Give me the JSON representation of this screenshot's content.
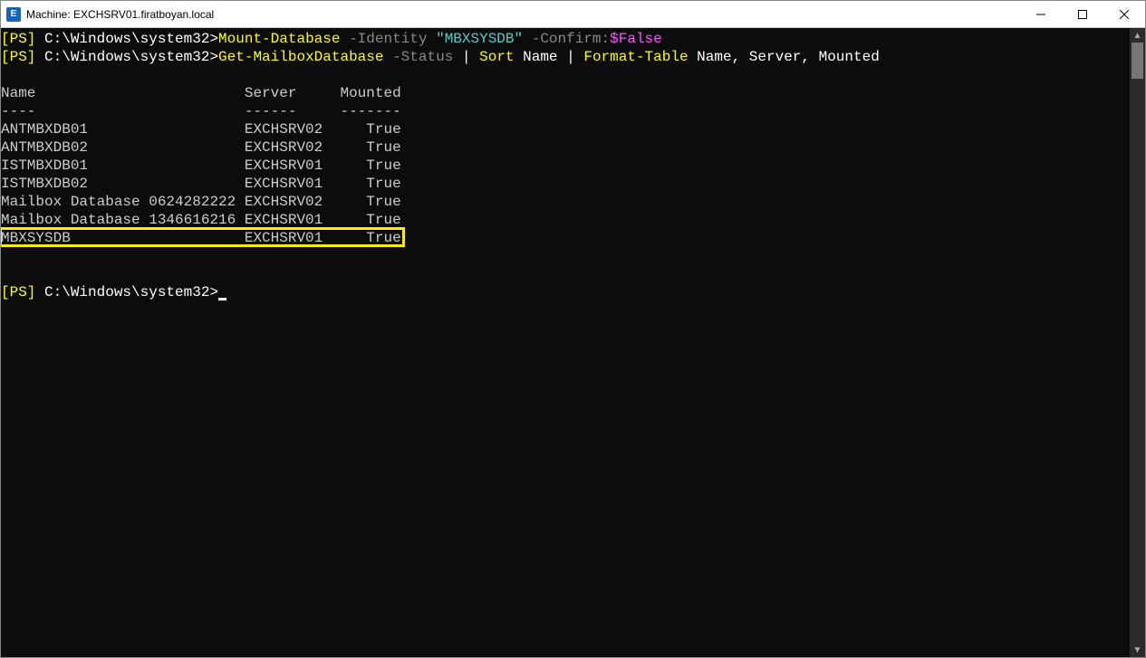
{
  "window": {
    "title": "Machine: EXCHSRV01.firatboyan.local",
    "app_icon_text": "E"
  },
  "prompt": {
    "ps": "[PS]",
    "path": "C:\\Windows\\system32>"
  },
  "cmd1": {
    "name": "Mount-Database",
    "param_identity": "-Identity",
    "identity_value": "\"MBXSYSDB\"",
    "param_confirm": "-Confirm:",
    "confirm_value": "$False"
  },
  "cmd2": {
    "name": "Get-MailboxDatabase",
    "param_status": "-Status",
    "pipe1": " | ",
    "sort": "Sort",
    "sort_arg": "Name",
    "pipe2": " | ",
    "format": "Format-Table",
    "format_args": "Name, Server, Mounted"
  },
  "table": {
    "headers": {
      "name": "Name",
      "server": "Server",
      "mounted": "Mounted"
    },
    "dividers": {
      "name": "----",
      "server": "------",
      "mounted": "-------"
    },
    "rows": [
      {
        "name": "ANTMBXDB01",
        "server": "EXCHSRV02",
        "mounted": "True"
      },
      {
        "name": "ANTMBXDB02",
        "server": "EXCHSRV02",
        "mounted": "True"
      },
      {
        "name": "ISTMBXDB01",
        "server": "EXCHSRV01",
        "mounted": "True"
      },
      {
        "name": "ISTMBXDB02",
        "server": "EXCHSRV01",
        "mounted": "True"
      },
      {
        "name": "Mailbox Database 0624282222",
        "server": "EXCHSRV02",
        "mounted": "True"
      },
      {
        "name": "Mailbox Database 1346616216",
        "server": "EXCHSRV01",
        "mounted": "True"
      },
      {
        "name": "MBXSYSDB",
        "server": "EXCHSRV01",
        "mounted": "True"
      }
    ],
    "col_widths": {
      "name": 28,
      "server": 10,
      "mounted": 8
    },
    "highlight_row_index": 6
  }
}
